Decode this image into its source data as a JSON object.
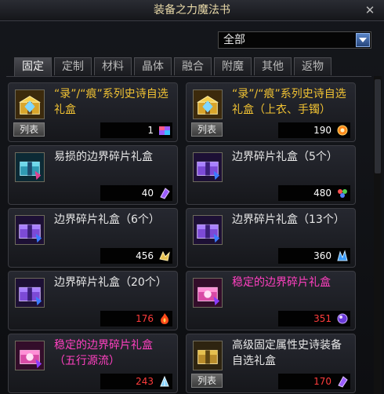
{
  "window": {
    "title": "装备之力魔法书"
  },
  "filter": {
    "selected": "全部"
  },
  "tabs": [
    {
      "label": "固定",
      "active": true
    },
    {
      "label": "定制"
    },
    {
      "label": "材料"
    },
    {
      "label": "晶体"
    },
    {
      "label": "融合"
    },
    {
      "label": "附魔"
    },
    {
      "label": "其他"
    },
    {
      "label": "返物"
    }
  ],
  "badge_label": "列表",
  "colors": {
    "gold": "#f1c233",
    "white": "#e8e8e8",
    "magenta": "#ff40c0",
    "count_white": "#ffffff",
    "count_red": "#ff3c3c"
  },
  "items": [
    {
      "name": "“录”/“痕”系列史诗自选礼盒",
      "count": "1",
      "name_color": "gold",
      "count_color": "count_white",
      "has_list": true,
      "icon": "gold-chest-icon",
      "count_icon": "rainbow-box-icon"
    },
    {
      "name": "“录”/“痕”系列史诗自选礼盒（上衣、手镯）",
      "count": "190",
      "name_color": "gold",
      "count_color": "count_white",
      "has_list": true,
      "icon": "gold-chest-icon",
      "count_icon": "orange-orb-icon"
    },
    {
      "name": "易损的边界碎片礼盒",
      "count": "40",
      "name_color": "white",
      "count_color": "count_white",
      "has_list": false,
      "icon": "teal-box-icon",
      "count_icon": "purple-crystal-icon"
    },
    {
      "name": "边界碎片礼盒（5个）",
      "count": "480",
      "name_color": "white",
      "count_color": "count_white",
      "has_list": false,
      "icon": "purple-box-icon",
      "count_icon": "rainbow-gem-icon"
    },
    {
      "name": "边界碎片礼盒（6个）",
      "count": "456",
      "name_color": "white",
      "count_color": "count_white",
      "has_list": false,
      "icon": "purple-box-icon",
      "count_icon": "gold-shard-icon"
    },
    {
      "name": "边界碎片礼盒（13个）",
      "count": "360",
      "name_color": "white",
      "count_color": "count_white",
      "has_list": false,
      "icon": "purple-box-icon",
      "count_icon": "blue-crystal-icon"
    },
    {
      "name": "边界碎片礼盒（20个）",
      "count": "176",
      "name_color": "white",
      "count_color": "count_red",
      "has_list": false,
      "icon": "purple-box-icon",
      "count_icon": "fire-icon"
    },
    {
      "name": "稳定的边界碎片礼盒",
      "count": "351",
      "name_color": "magenta",
      "count_color": "count_red",
      "has_list": false,
      "icon": "pink-box-icon",
      "count_icon": "purple-orb-icon"
    },
    {
      "name": "稳定的边界碎片礼盒（五行源流）",
      "count": "243",
      "name_color": "magenta",
      "count_color": "count_red",
      "has_list": false,
      "icon": "pink-box-icon",
      "count_icon": "ice-crystal-icon"
    },
    {
      "name": "高级固定属性史诗装备自选礼盒",
      "count": "170",
      "name_color": "white",
      "count_color": "count_red",
      "has_list": true,
      "icon": "gold-box-icon",
      "count_icon": "purple-crystal-icon"
    }
  ]
}
